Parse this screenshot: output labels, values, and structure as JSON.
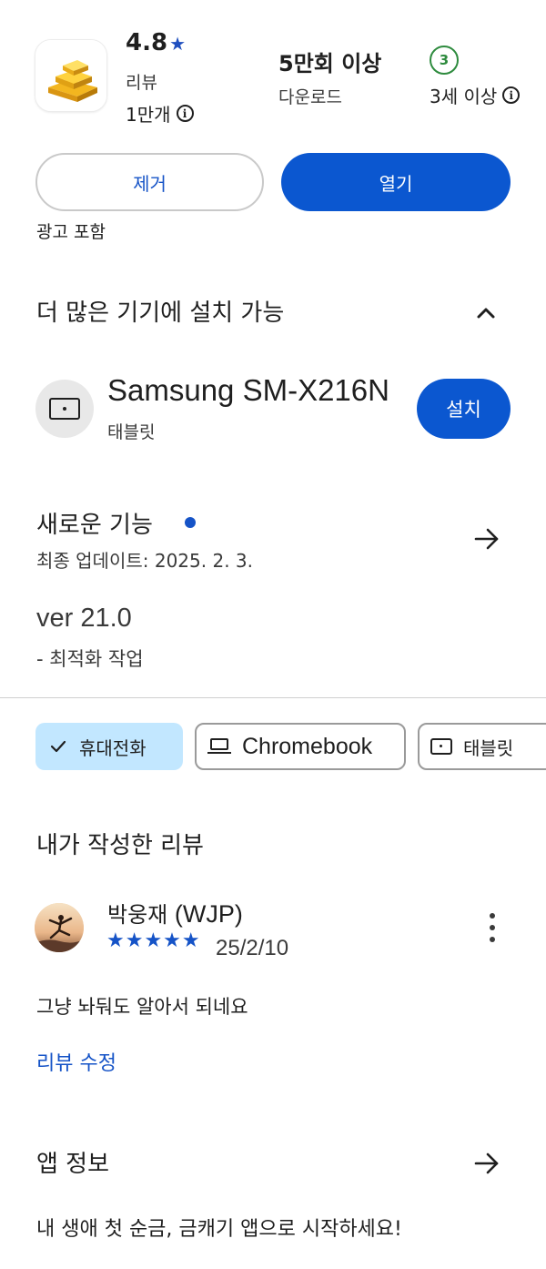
{
  "header": {
    "rating": "4.8",
    "rating_star": "★",
    "reviews_label": "리뷰",
    "reviews_count": "1만개",
    "downloads_value": "5만회 이상",
    "downloads_label": "다운로드",
    "age_badge": "3",
    "age_label": "3세 이상",
    "info_icon": "i",
    "app_icon": "gold-bars-icon"
  },
  "actions": {
    "uninstall_label": "제거",
    "open_label": "열기",
    "ads_note": "광고 포함"
  },
  "more_devices": {
    "title": "더 많은 기기에 설치 가능",
    "device_name": "Samsung SM-X216N",
    "device_type": "태블릿",
    "install_label": "설치"
  },
  "whats_new": {
    "title": "새로운 기능",
    "updated": "최종 업데이트: 2025. 2. 3.",
    "version": "ver 21.0",
    "note": "- 최적화 작업"
  },
  "device_chips": [
    {
      "label": "휴대전화",
      "selected": true
    },
    {
      "label": "Chromebook",
      "selected": false
    },
    {
      "label": "태블릿",
      "selected": false
    }
  ],
  "my_review": {
    "title": "내가 작성한 리뷰",
    "reviewer_korean": "박웅재",
    "reviewer_latin": "(WJP)",
    "stars": "★★★★★",
    "rating": 5,
    "date": "25/2/10",
    "text": "그냥 놔둬도 알아서 되네요",
    "edit_label": "리뷰 수정"
  },
  "app_info": {
    "title": "앱 정보",
    "description": "내 생애 첫 순금, 금캐기 앱으로 시작하세요!"
  },
  "colors": {
    "primary": "#0b57d0",
    "link": "#1553c7",
    "chip_selected": "#c2e7ff",
    "age_green": "#2e8b3e"
  }
}
